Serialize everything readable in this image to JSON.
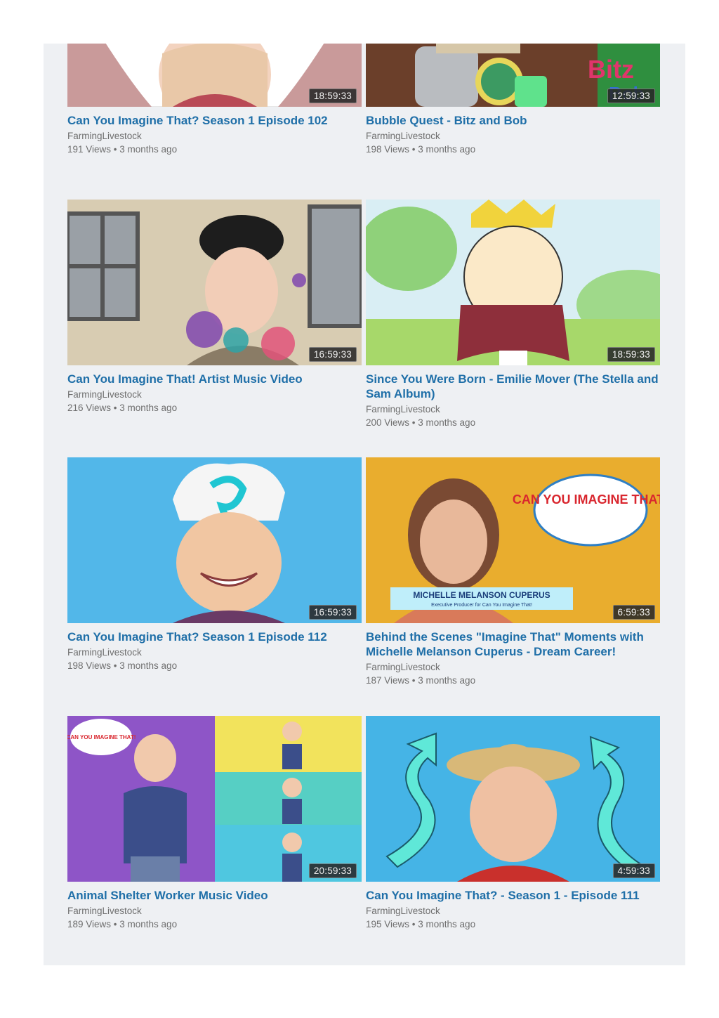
{
  "videos": [
    {
      "title": "Can You Imagine That? Season 1 Episode 102",
      "channel": "FarmingLivestock",
      "meta": "191 Views • 3 months ago",
      "duration": "18:59:33",
      "thumb_desc": "child-in-costume"
    },
    {
      "title": "Bubble Quest - Bitz and Bob",
      "channel": "FarmingLivestock",
      "meta": "198 Views • 3 months ago",
      "duration": "12:59:33",
      "thumb_desc": "bitz-and-bob-robot",
      "thumb_logo": "Bitz Bob"
    },
    {
      "title": "Can You Imagine That! Artist Music Video",
      "channel": "FarmingLivestock",
      "meta": "216 Views • 3 months ago",
      "duration": "16:59:33",
      "thumb_desc": "child-artist-beret"
    },
    {
      "title": "Since You Were Born - Emilie Mover (The Stella and Sam Album)",
      "channel": "FarmingLivestock",
      "meta": "200 Views • 3 months ago",
      "duration": "18:59:33",
      "thumb_desc": "cartoon-boy-cape"
    },
    {
      "title": "Can You Imagine That? Season 1 Episode 112",
      "channel": "FarmingLivestock",
      "meta": "198 Views • 3 months ago",
      "duration": "16:59:33",
      "thumb_desc": "child-chef-hat"
    },
    {
      "title": "Behind the Scenes \"Imagine That\" Moments with Michelle Melanson Cuperus - Dream Career!",
      "channel": "FarmingLivestock",
      "meta": "187 Views • 3 months ago",
      "duration": "6:59:33",
      "thumb_desc": "producer-interview",
      "thumb_logo": "CAN YOU IMAGINE THAT!",
      "thumb_caption": "MICHELLE MELANSON CUPERUS",
      "thumb_subcaption": "Executive Producer for Can You Imagine That!"
    },
    {
      "title": "Animal Shelter Worker Music Video",
      "channel": "FarmingLivestock",
      "meta": "189 Views • 3 months ago",
      "duration": "20:59:33",
      "thumb_desc": "boy-pointing-panels",
      "thumb_logo": "CAN YOU IMAGINE THAT!"
    },
    {
      "title": "Can You Imagine That? - Season 1 - Episode 111",
      "channel": "FarmingLivestock",
      "meta": "195 Views • 3 months ago",
      "duration": "4:59:33",
      "thumb_desc": "boy-cowboy-hat"
    }
  ]
}
